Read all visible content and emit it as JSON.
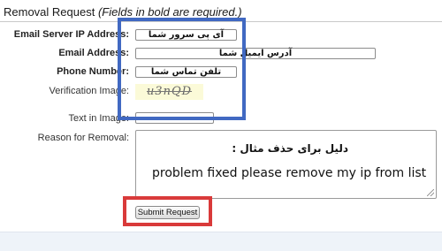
{
  "header": {
    "title": "Removal Request",
    "note": "(Fields in bold are required.)"
  },
  "form": {
    "server_ip_label": "Email Server IP Address:",
    "server_ip_value": "آی پی سرور شما",
    "email_label": "Email Address:",
    "email_value": "آدرس ایمیل شما",
    "phone_label": "Phone Number:",
    "phone_value": "تلفن تماس شما",
    "verification_label": "Verification Image:",
    "captcha_text": "u3nQD",
    "text_in_image_label": "Text in Image:",
    "text_in_image_value": "",
    "reason_label": "Reason for Removal:",
    "reason_line1": "دلیل برای حذف مثال :",
    "reason_line2": "problem fixed please remove my ip from list",
    "submit_label": "Submit Request"
  },
  "colors": {
    "highlight_blue": "#4169c2",
    "highlight_red": "#d93a3a",
    "captcha_bg": "#fbfad8"
  }
}
